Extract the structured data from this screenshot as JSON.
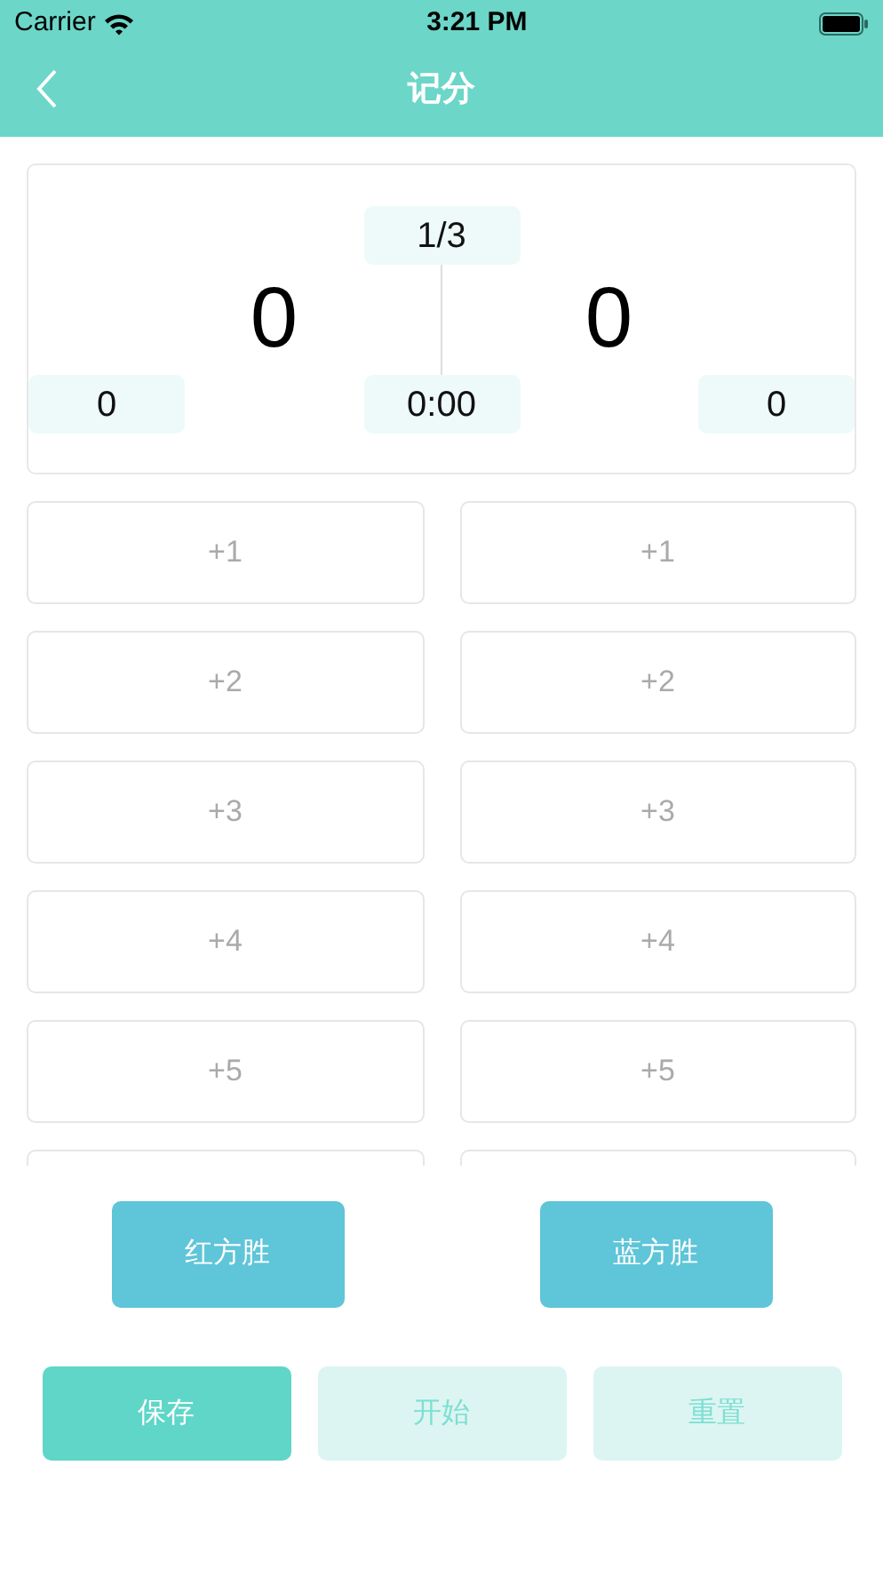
{
  "status_bar": {
    "carrier": "Carrier",
    "time": "3:21 PM"
  },
  "nav": {
    "title": "记分"
  },
  "scoreboard": {
    "period": "1/3",
    "left_score": "0",
    "right_score": "0",
    "left_fouls": "0",
    "timer": "0:00",
    "right_fouls": "0"
  },
  "score_buttons": [
    {
      "left": "+1",
      "right": "+1"
    },
    {
      "left": "+2",
      "right": "+2"
    },
    {
      "left": "+3",
      "right": "+3"
    },
    {
      "left": "+4",
      "right": "+4"
    },
    {
      "left": "+5",
      "right": "+5"
    }
  ],
  "win_buttons": [
    "红方胜",
    "蓝方胜"
  ],
  "actions": [
    {
      "label": "保存",
      "kind": "primary"
    },
    {
      "label": "开始",
      "kind": "light"
    },
    {
      "label": "重置",
      "kind": "light"
    }
  ]
}
